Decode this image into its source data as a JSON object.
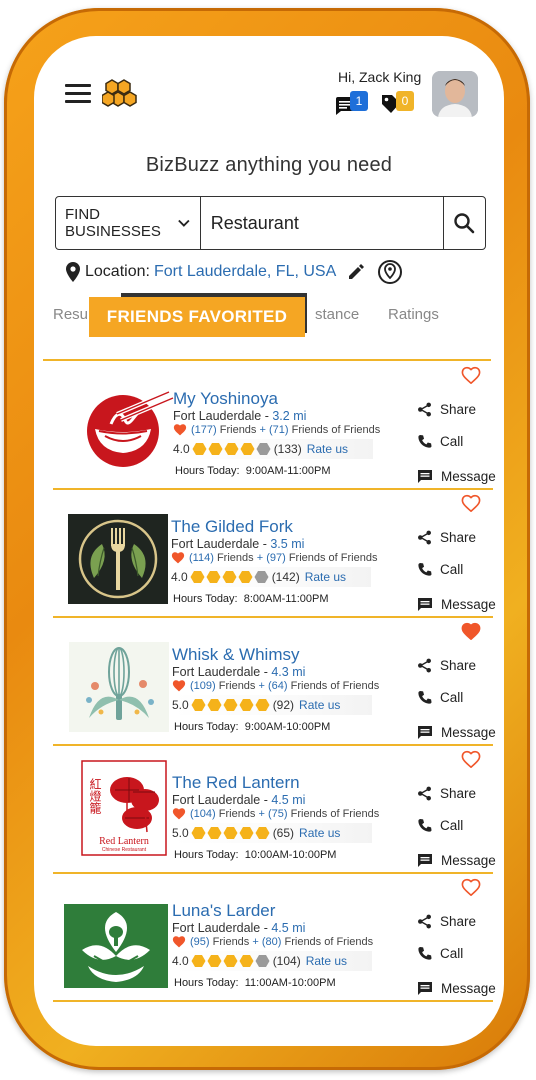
{
  "header": {
    "greeting": "Hi, Zack King",
    "messages_count": "1",
    "tags_count": "0"
  },
  "tagline": "BizBuzz anything you need",
  "search": {
    "category": "FIND BUSINESSES",
    "query": "Restaurant"
  },
  "location": {
    "label": "Location:",
    "value": "Fort Lauderdale, FL, USA"
  },
  "tabs": {
    "results": "Resu",
    "active": "FRIENDS FAVORITED",
    "distance": "stance",
    "ratings": "Ratings"
  },
  "actions": {
    "share": "Share",
    "call": "Call",
    "message": "Message"
  },
  "labels": {
    "friends": "Friends",
    "friends_of_friends": "Friends of Friends",
    "rate_us": "Rate us",
    "hours_today": "Hours Today:"
  },
  "colors": {
    "accent": "#f5a623",
    "link": "#2b6cb0",
    "heart": "#f0562a"
  },
  "listings": [
    {
      "name": "My Yoshinoya",
      "city": "Fort Lauderdale - ",
      "distance": "3.2 mi",
      "friends": "(177)",
      "friends_of_friends": "(71)",
      "rating": "4.0",
      "stars": 4,
      "reviews": "(133)",
      "hours": "9:00AM-11:00PM",
      "favorited": false
    },
    {
      "name": "The Gilded Fork",
      "city": "Fort Lauderdale - ",
      "distance": "3.5 mi",
      "friends": "(114)",
      "friends_of_friends": "(97)",
      "rating": "4.0",
      "stars": 4,
      "reviews": "(142)",
      "hours": "8:00AM-11:00PM",
      "favorited": false
    },
    {
      "name": "Whisk & Whimsy",
      "city": "Fort Lauderdale - ",
      "distance": "4.3 mi",
      "friends": "(109)",
      "friends_of_friends": "(64)",
      "rating": "5.0",
      "stars": 5,
      "reviews": "(92)",
      "hours": "9:00AM-10:00PM",
      "favorited": true
    },
    {
      "name": "The Red Lantern",
      "city": "Fort Lauderdale - ",
      "distance": "4.5 mi",
      "friends": "(104)",
      "friends_of_friends": "(75)",
      "rating": "5.0",
      "stars": 5,
      "reviews": "(65)",
      "hours": "10:00AM-10:00PM",
      "favorited": false,
      "logo_text_cn": "紅燈籠",
      "logo_text": "Red Lantern",
      "logo_subtext": "Chinese Restaurant"
    },
    {
      "name": "Luna's Larder",
      "city": "Fort Lauderdale - ",
      "distance": "4.5 mi",
      "friends": "(95)",
      "friends_of_friends": "(80)",
      "rating": "4.0",
      "stars": 4,
      "reviews": "(104)",
      "hours": "11:00AM-10:00PM",
      "favorited": false
    }
  ]
}
